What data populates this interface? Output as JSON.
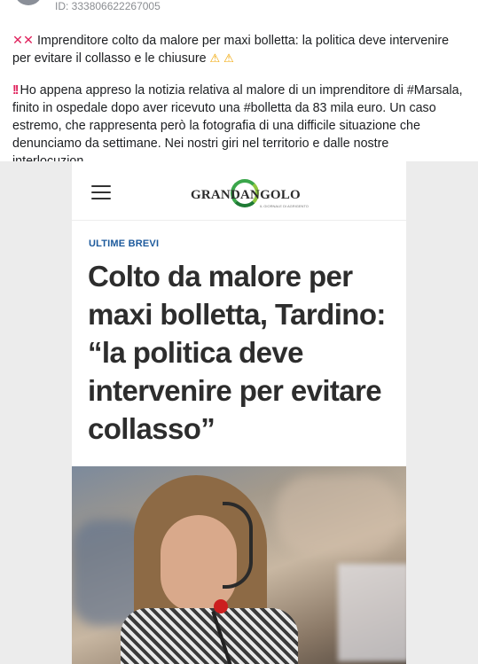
{
  "post": {
    "id_text": "ID: 333806622267005",
    "title_line1": "Imprenditore colto da malore per maxi bolletta: la politica deve intervenire",
    "title_line2": "per evitare il collasso e le chiusure",
    "x_glyph": "✕",
    "warn_glyph": "⚠",
    "bang_glyph": "!!",
    "body_line1": "Ho appena appreso la notizia relativa al malore di un imprenditore di #Marsala,",
    "body_line2": "finito in ospedale dopo aver ricevuto una #bolletta da 83 mila euro. Un caso",
    "body_line3": "estremo, che rappresenta però la fotografia di una difficile situazione che",
    "body_line4": "denunciamo da settimane. Nei nostri giri nel territorio e dalle nostre interlocuzion..."
  },
  "shared": {
    "logo_text": "GRANDANGOLO",
    "logo_subtitle": "IL GIORNALE DI AGRIGENTO",
    "category": "ULTIME BREVI",
    "headline": "Colto da malore per maxi bolletta, Tardino: “la politica deve intervenire per evitare collasso”"
  },
  "colors": {
    "accent_red": "#e0245e",
    "category_blue": "#1d5a9c",
    "logo_green": "#3aa64a"
  },
  "icons": [
    "cross-mark-icon",
    "warning-icon",
    "menu-icon",
    "double-exclamation-icon"
  ]
}
